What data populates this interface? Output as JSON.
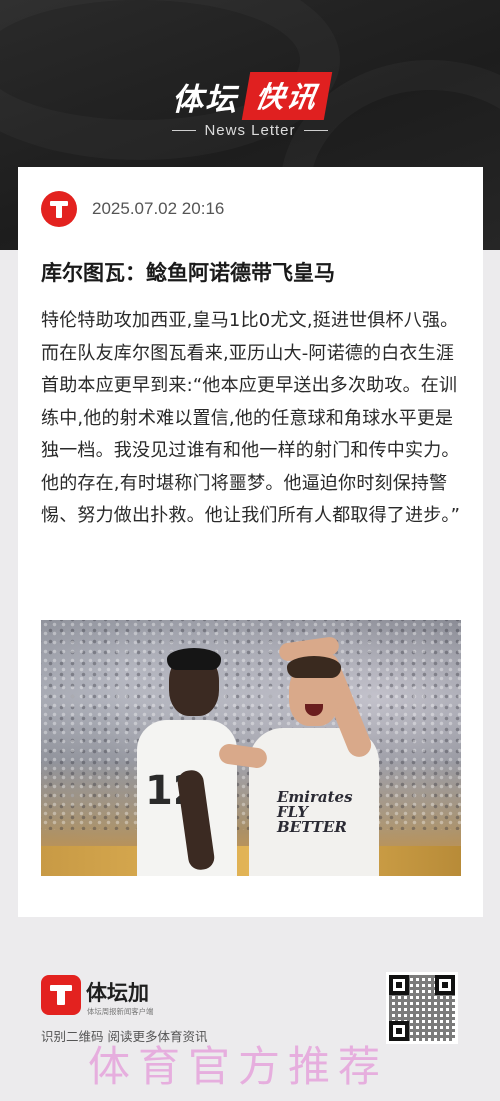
{
  "header": {
    "brand_left": "体坛",
    "brand_right": "快讯",
    "subtitle": "News Letter"
  },
  "article": {
    "datetime": "2025.07.02 20:16",
    "title": "库尔图瓦：鲶鱼阿诺德带飞皇马",
    "body": "特伦特助攻加西亚,皇马1比0尤文,挺进世俱杯八强。而在队友库尔图瓦看来,亚历山大-阿诺德的白衣生涯首助本应更早到来:“他本应更早送出多次助攻。在训练中,他的射术难以置信,他的任意球和角球水平更是独一档。我没见过谁有和他一样的射门和传中实力。他的存在,有时堪称门将噩梦。他逼迫你时刻保持警惕、努力做出扑救。他让我们所有人都取得了进步。”",
    "photo": {
      "player1_number": "12",
      "player2_sponsor": "Emirates FLY BETTER"
    }
  },
  "footer": {
    "app_name": "体坛加",
    "app_subtitle": "体坛周报新闻客户端",
    "scan_text": "识别二维码 阅读更多体育资讯",
    "watermark": "体育官方推荐"
  },
  "colors": {
    "brand_red": "#e3221f",
    "header_bg": "#222222",
    "page_bg": "#ecebed",
    "watermark": "#e6a8dd"
  },
  "icons": {
    "header_logo": "titan-t-logo",
    "footer_logo": "titan-t-logo",
    "qr": "qr-code"
  }
}
